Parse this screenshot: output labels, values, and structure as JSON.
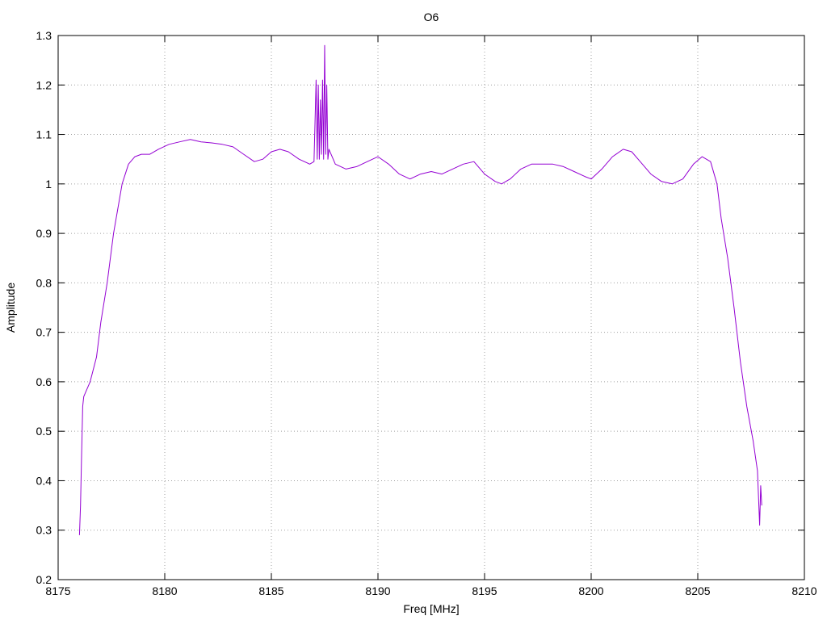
{
  "chart_data": {
    "type": "line",
    "title": "O6",
    "xlabel": "Freq [MHz]",
    "ylabel": "Amplitude",
    "xlim": [
      8175,
      8210
    ],
    "ylim": [
      0.2,
      1.3
    ],
    "xticks": [
      "8175",
      "8180",
      "8185",
      "8190",
      "8195",
      "8200",
      "8205",
      "8210"
    ],
    "yticks": [
      "0.2",
      "0.3",
      "0.4",
      "0.5",
      "0.6",
      "0.7",
      "0.8",
      "0.9",
      "1",
      "1.1",
      "1.2",
      "1.3"
    ],
    "grid": true,
    "series": [
      {
        "color": "#9400d3",
        "x": [
          8176.0,
          8176.05,
          8176.1,
          8176.15,
          8176.2,
          8176.3,
          8176.5,
          8176.8,
          8177.0,
          8177.3,
          8177.6,
          8178.0,
          8178.3,
          8178.6,
          8178.9,
          8179.3,
          8179.7,
          8180.2,
          8180.7,
          8181.2,
          8181.7,
          8182.2,
          8182.7,
          8183.2,
          8183.7,
          8184.2,
          8184.6,
          8185.0,
          8185.4,
          8185.8,
          8186.3,
          8186.8,
          8187.0,
          8187.1,
          8187.15,
          8187.2,
          8187.25,
          8187.3,
          8187.35,
          8187.4,
          8187.45,
          8187.5,
          8187.55,
          8187.6,
          8187.65,
          8187.7,
          8188.0,
          8188.5,
          8189.0,
          8189.5,
          8190.0,
          8190.5,
          8191.0,
          8191.5,
          8192.0,
          8192.5,
          8193.0,
          8193.5,
          8194.0,
          8194.5,
          8195.0,
          8195.5,
          8195.8,
          8196.2,
          8196.7,
          8197.2,
          8197.7,
          8198.2,
          8198.7,
          8199.2,
          8199.7,
          8200.0,
          8200.5,
          8201.0,
          8201.5,
          8201.9,
          8202.3,
          8202.8,
          8203.3,
          8203.8,
          8204.3,
          8204.8,
          8205.2,
          8205.6,
          8205.9,
          8206.1,
          8206.4,
          8206.7,
          8207.0,
          8207.3,
          8207.6,
          8207.8,
          8207.9,
          8207.95,
          8208.0
        ],
        "y": [
          0.29,
          0.35,
          0.45,
          0.55,
          0.57,
          0.58,
          0.6,
          0.65,
          0.72,
          0.8,
          0.9,
          1.0,
          1.04,
          1.055,
          1.06,
          1.06,
          1.07,
          1.08,
          1.085,
          1.09,
          1.085,
          1.083,
          1.08,
          1.075,
          1.06,
          1.045,
          1.05,
          1.065,
          1.07,
          1.065,
          1.05,
          1.04,
          1.045,
          1.21,
          1.05,
          1.2,
          1.05,
          1.17,
          1.06,
          1.21,
          1.05,
          1.28,
          1.06,
          1.2,
          1.05,
          1.07,
          1.04,
          1.03,
          1.035,
          1.045,
          1.055,
          1.04,
          1.02,
          1.01,
          1.02,
          1.025,
          1.02,
          1.03,
          1.04,
          1.045,
          1.02,
          1.005,
          1.0,
          1.01,
          1.03,
          1.04,
          1.04,
          1.04,
          1.035,
          1.025,
          1.015,
          1.01,
          1.03,
          1.055,
          1.07,
          1.065,
          1.045,
          1.02,
          1.005,
          1.0,
          1.01,
          1.04,
          1.055,
          1.045,
          1.0,
          0.93,
          0.85,
          0.75,
          0.64,
          0.55,
          0.48,
          0.42,
          0.31,
          0.39,
          0.35
        ]
      }
    ]
  }
}
